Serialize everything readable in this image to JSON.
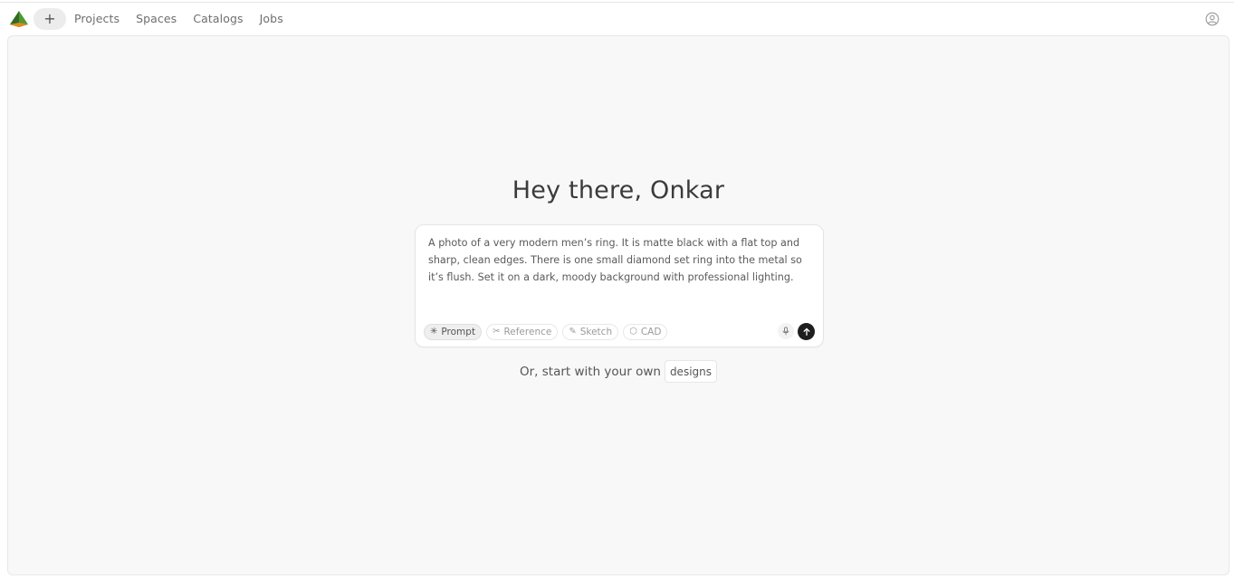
{
  "nav": {
    "new_label": "+",
    "links": [
      "Projects",
      "Spaces",
      "Catalogs",
      "Jobs"
    ]
  },
  "main": {
    "greeting": "Hey there, Onkar",
    "prompt_text": "A photo of a very modern men’s ring. It is matte black with a flat top and sharp, clean edges. There is one small diamond set ring into the metal so it’s flush. Set it on a dark, moody background with professional lighting.",
    "modes": [
      {
        "label": "Prompt",
        "icon": "asterisk-icon",
        "active": true
      },
      {
        "label": "Reference",
        "icon": "scissors-icon",
        "active": false
      },
      {
        "label": "Sketch",
        "icon": "pencil-icon",
        "active": false
      },
      {
        "label": "CAD",
        "icon": "cube-icon",
        "active": false
      }
    ],
    "alt_text": "Or, start with your own",
    "alt_button": "designs"
  },
  "colors": {
    "logo_green": "#3a7d2e",
    "logo_orange": "#e08a1e",
    "send_bg": "#1e1e1e"
  }
}
